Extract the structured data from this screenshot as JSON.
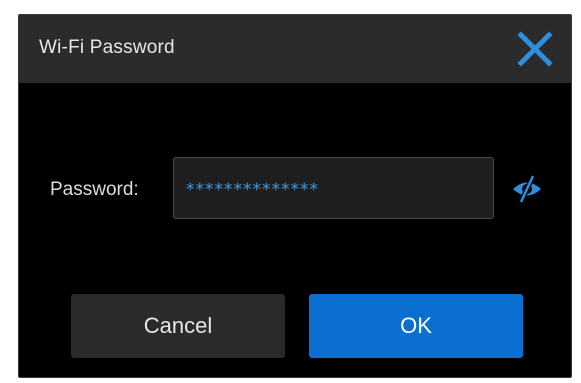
{
  "dialog": {
    "title": "Wi-Fi Password",
    "close_icon": "close-icon",
    "accent_color": "#0a6fd1",
    "icon_color": "#2e8fe0"
  },
  "password": {
    "label": "Password:",
    "masked_value": "**************",
    "visibility_toggle_icon": "eye-slash-icon"
  },
  "buttons": {
    "cancel_label": "Cancel",
    "ok_label": "OK"
  }
}
